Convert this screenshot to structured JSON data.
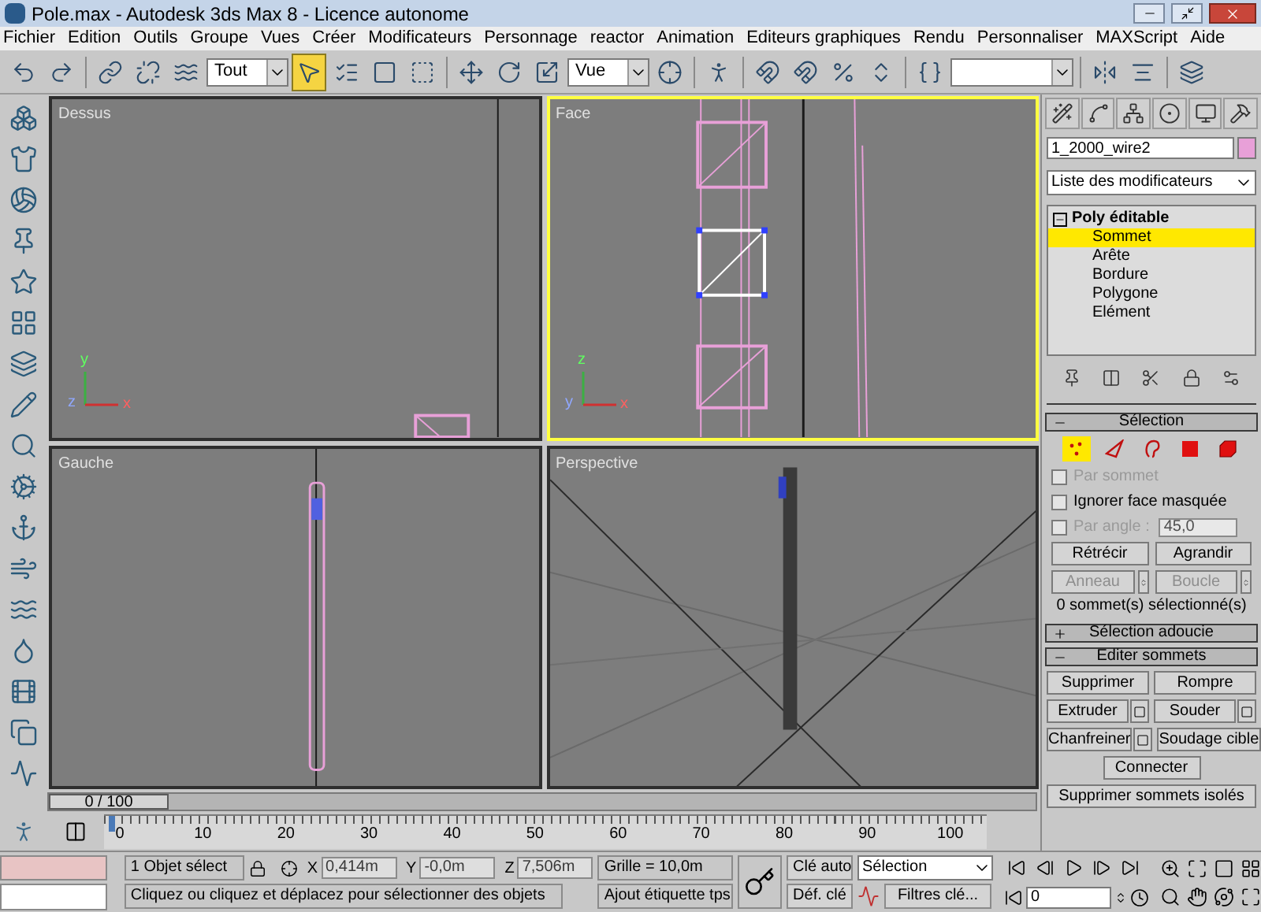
{
  "window": {
    "title": "Pole.max - Autodesk 3ds Max 8  - Licence autonome"
  },
  "menu": [
    "Fichier",
    "Edition",
    "Outils",
    "Groupe",
    "Vues",
    "Créer",
    "Modificateurs",
    "Personnage",
    "reactor",
    "Animation",
    "Editeurs graphiques",
    "Rendu",
    "Personnaliser",
    "MAXScript",
    "Aide"
  ],
  "toolbar": [
    {
      "kind": "button",
      "selected": false
    },
    {
      "kind": "button",
      "selected": false
    },
    {
      "kind": "separator"
    },
    {
      "kind": "button",
      "selected": false
    },
    {
      "kind": "button",
      "selected": false
    },
    {
      "kind": "button",
      "selected": false
    },
    {
      "kind": "dropdown",
      "value": "Tout"
    },
    {
      "kind": "button",
      "selected": true
    },
    {
      "kind": "button",
      "selected": false
    },
    {
      "kind": "button",
      "selected": false
    },
    {
      "kind": "button",
      "selected": false
    },
    {
      "kind": "separator"
    },
    {
      "kind": "button",
      "selected": false
    },
    {
      "kind": "button",
      "selected": false
    },
    {
      "kind": "button",
      "selected": false
    },
    {
      "kind": "dropdown",
      "value": "Vue"
    },
    {
      "kind": "button",
      "selected": false
    },
    {
      "kind": "separator"
    },
    {
      "kind": "button",
      "selected": false
    },
    {
      "kind": "separator"
    },
    {
      "kind": "button",
      "selected": false
    },
    {
      "kind": "button",
      "selected": false
    },
    {
      "kind": "button",
      "selected": false
    },
    {
      "kind": "button",
      "selected": false
    },
    {
      "kind": "separator"
    },
    {
      "kind": "button",
      "selected": false
    },
    {
      "kind": "dropdown"
    },
    {
      "kind": "separator"
    },
    {
      "kind": "button",
      "selected": false
    },
    {
      "kind": "button",
      "selected": false
    },
    {
      "kind": "separator"
    },
    {
      "kind": "button",
      "selected": false
    }
  ],
  "viewports": [
    {
      "label": "Dessus",
      "active": false,
      "axes": [
        "y",
        "z",
        "x"
      ]
    },
    {
      "label": "Face",
      "active": true,
      "axes": [
        "z",
        "y",
        "x"
      ]
    },
    {
      "label": "Gauche",
      "active": false
    },
    {
      "label": "Perspective",
      "active": false
    }
  ],
  "command_panel": {
    "object_name": "1_2000_wire2",
    "modifier_list": "Liste des modificateurs",
    "stack": {
      "label": "Poly éditable",
      "expanded": true,
      "children": [
        {
          "label": "Sommet",
          "selected": true
        },
        {
          "label": "Arête",
          "selected": false
        },
        {
          "label": "Bordure",
          "selected": false
        },
        {
          "label": "Polygone",
          "selected": false
        },
        {
          "label": "Elément",
          "selected": false
        }
      ]
    },
    "rollouts": [
      {
        "kind": "selection",
        "title": "Sélection",
        "expanded": true,
        "subobjects": [
          {
            "selected": true
          },
          {
            "selected": false
          },
          {
            "selected": false
          },
          {
            "selected": false
          },
          {
            "selected": false
          }
        ],
        "options": [
          {
            "label": "Par sommet",
            "checked": false,
            "disabled": true
          },
          {
            "label": "Ignorer face masquée",
            "checked": false,
            "disabled": false
          },
          {
            "label": "Par angle :",
            "checked": false,
            "disabled": true,
            "value": "45,0"
          }
        ],
        "buttons": [
          {
            "label": "Rétrécir",
            "kind": "plain",
            "disabled": false
          },
          {
            "label": "Agrandir",
            "kind": "plain",
            "disabled": false
          },
          {
            "label": "Anneau",
            "kind": "spinner",
            "disabled": true
          },
          {
            "label": "Boucle",
            "kind": "spinner",
            "disabled": true
          }
        ],
        "summary": "0 sommet(s) sélectionné(s)"
      },
      {
        "title": "Sélection adoucie",
        "expanded": false
      },
      {
        "kind": "edit",
        "title": "Editer sommets",
        "expanded": true,
        "rows": [
          [
            {
              "label": "Supprimer",
              "kind": "plain"
            },
            {
              "label": "Rompre",
              "kind": "plain"
            }
          ],
          [
            {
              "label": "Extruder",
              "kind": "settings"
            },
            {
              "label": "Souder",
              "kind": "settings"
            }
          ],
          [
            {
              "label": "Chanfreiner",
              "kind": "settings"
            },
            {
              "label": "Soudage cible",
              "kind": "plain"
            }
          ],
          [
            {
              "label": "Connecter",
              "kind": "plain"
            }
          ],
          [
            {
              "label": "Supprimer sommets isolés",
              "kind": "wide"
            }
          ]
        ]
      }
    ]
  },
  "timeline": {
    "slider": "0 / 100",
    "level": 0,
    "ticks": [
      "0",
      "10",
      "20",
      "30",
      "40",
      "50",
      "60",
      "70",
      "80",
      "90",
      "100"
    ]
  },
  "status_bar": {
    "selection_count": "1 Objet sélect",
    "coords": [
      {
        "axis": "X",
        "value": "0,414m"
      },
      {
        "axis": "Y",
        "value": "-0,0m"
      },
      {
        "axis": "Z",
        "value": "7,506m"
      }
    ],
    "grid": "Grille = 10,0m",
    "prompt": "Cliquez ou cliquez et déplacez pour sélectionner des objets",
    "add_time_tag": "Ajout étiquette tps",
    "auto_key": "Clé auto",
    "set_key": "Déf. clé",
    "key_set": "Sélection",
    "key_filters": "Filtres clé...",
    "frame": "0"
  }
}
